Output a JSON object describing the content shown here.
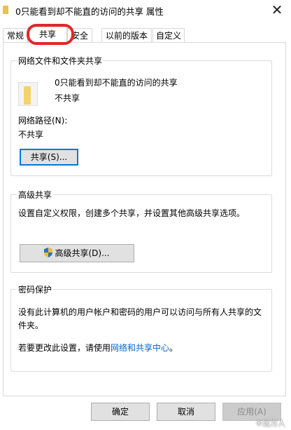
{
  "window": {
    "title": "0只能看到却不能直的访问的共享 属性",
    "close_glyph": "✕"
  },
  "tabs": [
    {
      "label": "常规"
    },
    {
      "label": "共享"
    },
    {
      "label": "安全"
    },
    {
      "label": "以前的版本"
    },
    {
      "label": "自定义"
    }
  ],
  "active_tab": "共享",
  "highlight_color": "#e3262b",
  "network_section": {
    "title": "网络文件和文件夹共享",
    "folder_name": "0只能看到却不能直的访问的共享",
    "share_state": "不共享",
    "path_label": "网络路径(N):",
    "path_value": "不共享",
    "share_button": "共享(S)..."
  },
  "advanced_section": {
    "title": "高级共享",
    "description": "设置自定义权限，创建多个共享，并设置其他高级共享选项。",
    "button": "高级共享(D)..."
  },
  "password_section": {
    "title": "密码保护",
    "description_line1": "没有此计算机的用户帐户和密码的用户可以访问与所有人共享的文",
    "description_line2": "件夹。",
    "change_prefix": "若要更改此设置，请使用",
    "change_link": "网络和共享中心",
    "change_suffix": "。"
  },
  "footer": {
    "ok": "确定",
    "cancel": "取消",
    "apply": "应用(A)"
  },
  "watermark": "※远方人"
}
